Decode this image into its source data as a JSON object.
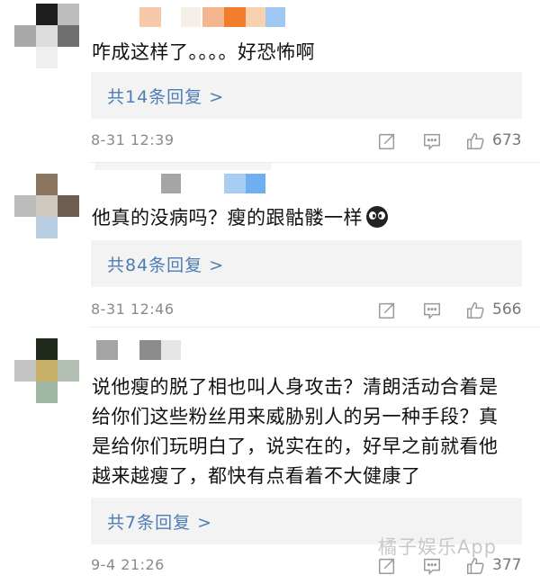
{
  "comments": [
    {
      "text": "咋成这样了。。。。好恐怖啊",
      "reply_label": "共14条回复 >",
      "time": "8-31 12:39",
      "likes": "673"
    },
    {
      "text": "他真的没病吗？瘦的跟骷髅一样",
      "emoji": "scared-face-emoji",
      "reply_label": "共84条回复 >",
      "time": "8-31 12:46",
      "likes": "566"
    },
    {
      "text_lines": [
        "说他瘦的脱了相也叫人身攻击？清朗活动合着是",
        "给你们这些粉丝用来威胁别人的另一种手段？真",
        "是给你们玩明白了，说实在的，好早之前就看他",
        "越来越瘦了，都快有点看着不大健康了"
      ],
      "reply_label": "共7条回复 >",
      "time": "9-4 21:26",
      "likes": "377"
    }
  ],
  "watermark": "橘子娱乐App",
  "icons": [
    "share-icon",
    "comment-icon",
    "like-icon"
  ],
  "colors": {
    "reply_link": "#4c7db5",
    "reply_bg": "#f3f3f3",
    "meta_text": "#8a8a8a"
  }
}
